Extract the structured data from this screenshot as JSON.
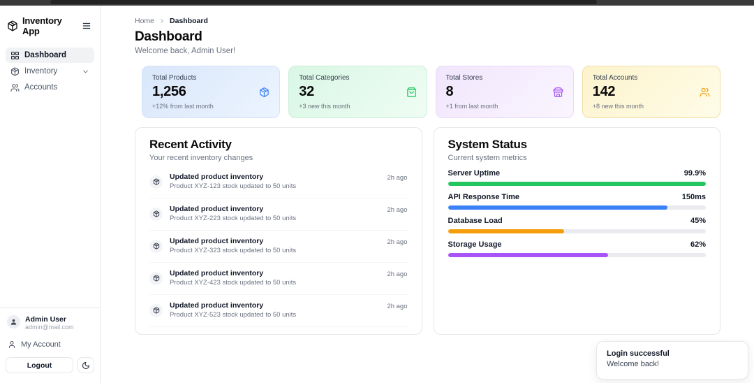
{
  "sidebar": {
    "app_name": "Inventory App",
    "nav": [
      {
        "label": "Dashboard",
        "active": true
      },
      {
        "label": "Inventory",
        "expandable": true
      },
      {
        "label": "Accounts"
      }
    ],
    "user_name": "Admin User",
    "user_email": "admin@mail.com",
    "my_account_label": "My Account",
    "logout_label": "Logout"
  },
  "header": {
    "breadcrumb_home": "Home",
    "breadcrumb_current": "Dashboard",
    "title": "Dashboard",
    "subtitle": "Welcome back, Admin User!"
  },
  "stats": [
    {
      "label": "Total Products",
      "value": "1,256",
      "sub": "+12% from last month",
      "icon": "package-icon",
      "accent": "#3b82f6"
    },
    {
      "label": "Total Categories",
      "value": "32",
      "sub": "+3 new this month",
      "icon": "shopping-bag-icon",
      "accent": "#22c55e"
    },
    {
      "label": "Total Stores",
      "value": "8",
      "sub": "+1 from last month",
      "icon": "store-icon",
      "accent": "#a855f7"
    },
    {
      "label": "Total Accounts",
      "value": "142",
      "sub": "+8 new this month",
      "icon": "users-icon",
      "accent": "#f59e0b"
    }
  ],
  "recent_activity": {
    "title": "Recent Activity",
    "subtitle": "Your recent inventory changes",
    "items": [
      {
        "title": "Updated product inventory",
        "description": "Product XYZ-123 stock updated to 50 units",
        "time": "2h ago"
      },
      {
        "title": "Updated product inventory",
        "description": "Product XYZ-223 stock updated to 50 units",
        "time": "2h ago"
      },
      {
        "title": "Updated product inventory",
        "description": "Product XYZ-323 stock updated to 50 units",
        "time": "2h ago"
      },
      {
        "title": "Updated product inventory",
        "description": "Product XYZ-423 stock updated to 50 units",
        "time": "2h ago"
      },
      {
        "title": "Updated product inventory",
        "description": "Product XYZ-523 stock updated to 50 units",
        "time": "2h ago"
      }
    ]
  },
  "system_status": {
    "title": "System Status",
    "subtitle": "Current system metrics",
    "metrics": [
      {
        "label": "Server Uptime",
        "value": "99.9%",
        "percent": 99.9,
        "color": "#22c55e"
      },
      {
        "label": "API Response Time",
        "value": "150ms",
        "percent": 85,
        "color": "#3b82f6"
      },
      {
        "label": "Database Load",
        "value": "45%",
        "percent": 45,
        "color": "#f59e0b"
      },
      {
        "label": "Storage Usage",
        "value": "62%",
        "percent": 62,
        "color": "#a855f7"
      }
    ]
  },
  "toast": {
    "title": "Login successful",
    "message": "Welcome back!"
  }
}
